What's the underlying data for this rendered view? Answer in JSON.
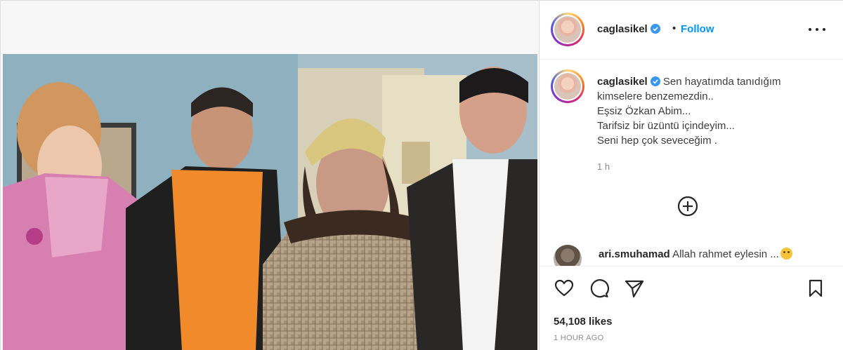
{
  "post": {
    "author": "caglasikel",
    "follow_label": "Follow",
    "separator": "•",
    "caption_lines": [
      "Sen hayatımda tanıdığım",
      "kimselere benzemezdin..",
      "Eşsiz Özkan Abim...",
      "Tarifsiz bir üzüntü içindeyim...",
      "Seni hep çok seveceğim ."
    ],
    "caption_time": "1 h",
    "likes": "54,108 likes",
    "posted_ago": "1 HOUR AGO"
  },
  "comment": {
    "author": "ari.smuhamad",
    "text": "Allah rahmet eylesin ..."
  },
  "icons": {
    "verified": "verified-badge-icon",
    "more": "more-options-icon",
    "add": "add-circle-icon",
    "like": "heart-icon",
    "comment": "comment-bubble-icon",
    "share": "paper-plane-icon",
    "save": "bookmark-icon"
  },
  "colors": {
    "accent": "#0095f6",
    "verified": "#3897f0",
    "muted": "#8e8e8e"
  }
}
